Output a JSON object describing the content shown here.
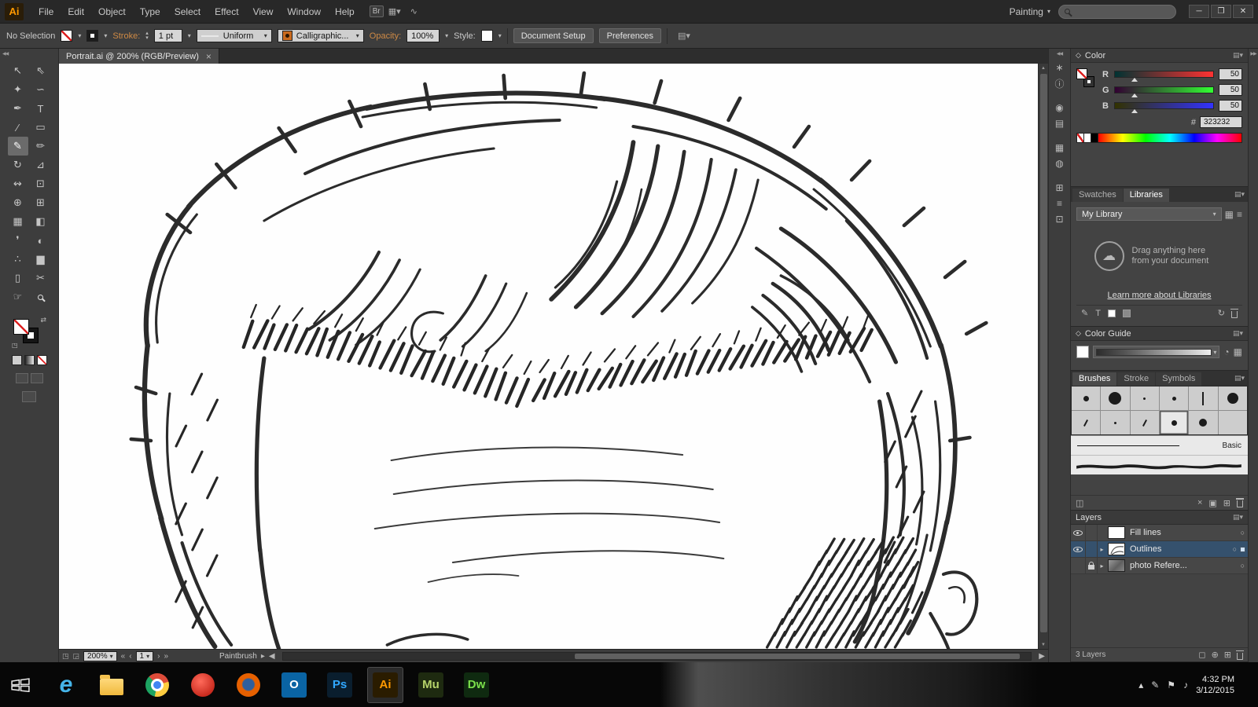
{
  "icons": {
    "chevron_down": "▾",
    "chevron_up": "▴",
    "chevron_right": "▸",
    "close": "×",
    "collapse_left": "◀◀",
    "collapse_right": "▶▶",
    "panel_menu": "▤",
    "target_circle": "○"
  },
  "menubar": {
    "logo": "Ai",
    "items": [
      "File",
      "Edit",
      "Object",
      "Type",
      "Select",
      "Effect",
      "View",
      "Window",
      "Help"
    ],
    "bridge_label": "Br",
    "workspace_label": "Painting",
    "search_value": ""
  },
  "controlbar": {
    "selection_label": "No Selection",
    "stroke_label": "Stroke:",
    "stroke_value": "1 pt",
    "variable_width_value": "Uniform",
    "brush_value": "Calligraphic...",
    "opacity_label": "Opacity:",
    "opacity_value": "100%",
    "style_label": "Style:",
    "document_setup_label": "Document Setup",
    "preferences_label": "Preferences"
  },
  "document": {
    "tab_title": "Portrait.ai @ 200% (RGB/Preview)",
    "zoom_value": "200%",
    "artboard_value": "1",
    "active_tool": "Paintbrush"
  },
  "toolbar": {
    "tools": [
      {
        "name": "selection-tool",
        "glyph": "↖"
      },
      {
        "name": "direct-selection-tool",
        "glyph": "⇖"
      },
      {
        "name": "magic-wand-tool",
        "glyph": "✦"
      },
      {
        "name": "lasso-tool",
        "glyph": "∽"
      },
      {
        "name": "pen-tool",
        "glyph": "✒"
      },
      {
        "name": "type-tool",
        "glyph": "T"
      },
      {
        "name": "line-segment-tool",
        "glyph": "∕"
      },
      {
        "name": "rectangle-tool",
        "glyph": "▭"
      },
      {
        "name": "paintbrush-tool",
        "glyph": "✎",
        "selected": true
      },
      {
        "name": "pencil-tool",
        "glyph": "✏"
      },
      {
        "name": "rotate-tool",
        "glyph": "↻"
      },
      {
        "name": "scale-tool",
        "glyph": "⊿"
      },
      {
        "name": "width-tool",
        "glyph": "↭"
      },
      {
        "name": "free-transform-tool",
        "glyph": "⊡"
      },
      {
        "name": "shape-builder-tool",
        "glyph": "⊕"
      },
      {
        "name": "perspective-grid-tool",
        "glyph": "⊞"
      },
      {
        "name": "mesh-tool",
        "glyph": "▦"
      },
      {
        "name": "gradient-tool",
        "glyph": "◧"
      },
      {
        "name": "eyedropper-tool",
        "glyph": "❜"
      },
      {
        "name": "blend-tool",
        "glyph": "◐"
      },
      {
        "name": "symbol-sprayer-tool",
        "glyph": "∴"
      },
      {
        "name": "column-graph-tool",
        "glyph": "▆"
      },
      {
        "name": "artboard-tool",
        "glyph": "▯"
      },
      {
        "name": "slice-tool",
        "glyph": "✂"
      },
      {
        "name": "hand-tool",
        "glyph": "☞"
      },
      {
        "name": "zoom-tool",
        "css": "magnifier"
      }
    ]
  },
  "dock_icons": [
    {
      "name": "symbols-panel-icon",
      "glyph": "∗"
    },
    {
      "name": "info-panel-icon",
      "glyph": "ⓘ"
    },
    {
      "name": "color-wheel-panel-icon",
      "glyph": "◉"
    },
    {
      "name": "appearance-panel-icon",
      "glyph": "▤"
    },
    {
      "name": "transform-panel-icon",
      "glyph": "▦"
    },
    {
      "name": "gradient-panel-icon",
      "glyph": "◍"
    },
    {
      "name": "transparency-panel-icon",
      "glyph": "⊞"
    },
    {
      "name": "align-panel-icon",
      "glyph": "≡"
    },
    {
      "name": "pathfinder-panel-icon",
      "glyph": "⊡"
    }
  ],
  "panels": {
    "color": {
      "title": "Color",
      "channels": [
        {
          "label": "R",
          "value": "50"
        },
        {
          "label": "G",
          "value": "50"
        },
        {
          "label": "B",
          "value": "50"
        }
      ],
      "hex_label": "#",
      "hex_value": "323232"
    },
    "libraries": {
      "tabs": [
        "Swatches",
        "Libraries"
      ],
      "active_tab": "Libraries",
      "library_select": "My Library",
      "drag_hint": "Drag anything here from your document",
      "learn_link": "Learn more about Libraries"
    },
    "color_guide": {
      "title": "Color Guide"
    },
    "brushes": {
      "tabs": [
        "Brushes",
        "Stroke",
        "Symbols"
      ],
      "active_tab": "Brushes",
      "cells": [
        [
          {
            "t": "dot",
            "s": 7
          },
          {
            "t": "dot",
            "s": 16
          },
          {
            "t": "dot",
            "s": 3
          },
          {
            "t": "dot",
            "s": 5
          },
          {
            "t": "bar"
          },
          {
            "t": "dot",
            "s": 14
          }
        ],
        [
          {
            "t": "tick"
          },
          {
            "t": "dot",
            "s": 3
          },
          {
            "t": "tick"
          },
          {
            "t": "dot",
            "s": 7,
            "sel": true
          },
          {
            "t": "dot",
            "s": 10
          },
          {
            "t": "none"
          }
        ]
      ],
      "basic_label": "Basic"
    },
    "layers": {
      "title": "Layers",
      "rows": [
        {
          "name": "Fill lines",
          "eye": true,
          "lock": false,
          "arrow": false,
          "thumb": "blank",
          "selected": false
        },
        {
          "name": "Outlines",
          "eye": true,
          "lock": false,
          "arrow": true,
          "thumb": "sketch",
          "selected": true
        },
        {
          "name": "photo Refere...",
          "eye": false,
          "lock": true,
          "arrow": true,
          "thumb": "photo",
          "selected": false
        }
      ],
      "count_label": "3 Layers"
    }
  },
  "taskbar": {
    "apps": [
      {
        "name": "internet-explorer",
        "kind": "ie"
      },
      {
        "name": "file-explorer",
        "kind": "folder"
      },
      {
        "name": "chrome",
        "kind": "chrome"
      },
      {
        "name": "opera",
        "kind": "red"
      },
      {
        "name": "firefox",
        "kind": "firefox"
      },
      {
        "name": "outlook",
        "kind": "label",
        "label": "O",
        "fg": "#ffffff",
        "bg": "#0a64a4"
      },
      {
        "name": "photoshop",
        "kind": "label",
        "label": "Ps",
        "fg": "#31a8ff",
        "bg": "#0a1e2e"
      },
      {
        "name": "illustrator",
        "kind": "label",
        "label": "Ai",
        "fg": "#ff9a00",
        "bg": "#2a1c00",
        "active": true
      },
      {
        "name": "muse",
        "kind": "label",
        "label": "Mu",
        "fg": "#b7d46b",
        "bg": "#1e2a10"
      },
      {
        "name": "dreamweaver",
        "kind": "label",
        "label": "Dw",
        "fg": "#7be04b",
        "bg": "#0f2a10"
      }
    ],
    "time": "4:32 PM",
    "date": "3/12/2015"
  }
}
